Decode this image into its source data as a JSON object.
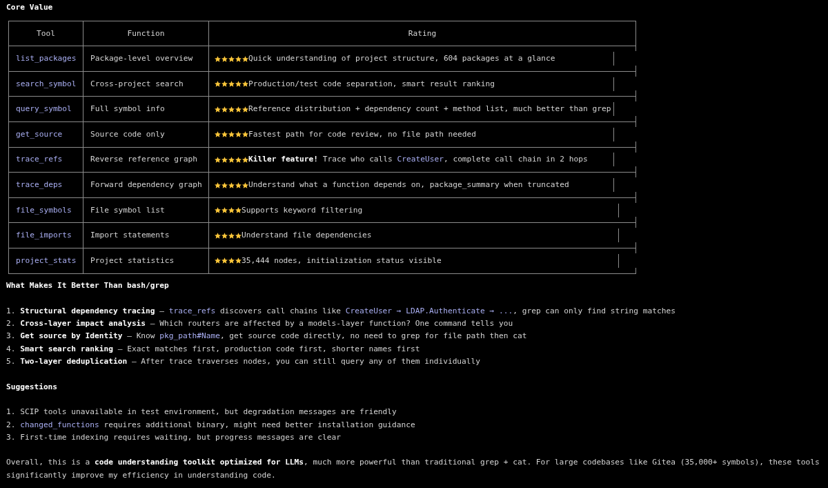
{
  "heading": "Core Value",
  "table": {
    "columns": [
      "Tool",
      "Function",
      "Rating"
    ],
    "rows": [
      {
        "tool": "list_packages",
        "function": "Package-level overview",
        "stars": 5,
        "rating": [
          {
            "kind": "plain",
            "text": "Quick understanding of project structure, 604 packages at a glance"
          }
        ]
      },
      {
        "tool": "search_symbol",
        "function": "Cross-project search",
        "stars": 5,
        "rating": [
          {
            "kind": "plain",
            "text": "Production/test code separation, smart result ranking"
          }
        ]
      },
      {
        "tool": "query_symbol",
        "function": "Full symbol info",
        "stars": 5,
        "rating": [
          {
            "kind": "plain",
            "text": "Reference distribution + dependency count + method list, much better than grep"
          }
        ]
      },
      {
        "tool": "get_source",
        "function": "Source code only",
        "stars": 5,
        "rating": [
          {
            "kind": "plain",
            "text": "Fastest path for code review, no file path needed"
          }
        ]
      },
      {
        "tool": "trace_refs",
        "function": "Reverse reference graph",
        "stars": 5,
        "rating": [
          {
            "kind": "bold",
            "text": "Killer feature!"
          },
          {
            "kind": "plain",
            "text": " Trace who calls "
          },
          {
            "kind": "code",
            "text": "CreateUser"
          },
          {
            "kind": "plain",
            "text": ", complete call chain in 2 hops"
          }
        ]
      },
      {
        "tool": "trace_deps",
        "function": "Forward dependency graph",
        "stars": 5,
        "rating": [
          {
            "kind": "plain",
            "text": "Understand what a function depends on, package_summary when truncated"
          }
        ]
      },
      {
        "tool": "file_symbols",
        "function": "File symbol list",
        "stars": 4,
        "rating": [
          {
            "kind": "plain",
            "text": "Supports keyword filtering"
          }
        ]
      },
      {
        "tool": "file_imports",
        "function": "Import statements",
        "stars": 4,
        "rating": [
          {
            "kind": "plain",
            "text": "Understand file dependencies"
          }
        ]
      },
      {
        "tool": "project_stats",
        "function": "Project statistics",
        "stars": 4,
        "rating": [
          {
            "kind": "plain",
            "text": "35,444 nodes, initialization status visible"
          }
        ]
      }
    ]
  },
  "sections": [
    {
      "title": "What Makes It Better Than bash/grep",
      "items": [
        {
          "number": "1.",
          "parts": [
            {
              "kind": "bold",
              "text": "Structural dependency tracing"
            },
            {
              "kind": "plain",
              "text": " – "
            },
            {
              "kind": "code",
              "text": "trace_refs"
            },
            {
              "kind": "plain",
              "text": " discovers call chains like "
            },
            {
              "kind": "code",
              "text": "CreateUser → LDAP.Authenticate → ..."
            },
            {
              "kind": "plain",
              "text": ", grep can only find string matches"
            }
          ]
        },
        {
          "number": "2.",
          "parts": [
            {
              "kind": "bold",
              "text": "Cross-layer impact analysis"
            },
            {
              "kind": "plain",
              "text": " – Which routers are affected by a models-layer function? One command tells you"
            }
          ]
        },
        {
          "number": "3.",
          "parts": [
            {
              "kind": "bold",
              "text": "Get source by Identity"
            },
            {
              "kind": "plain",
              "text": " – Know "
            },
            {
              "kind": "code",
              "text": "pkg_path#Name"
            },
            {
              "kind": "plain",
              "text": ", get source code directly, no need to grep for file path then cat"
            }
          ]
        },
        {
          "number": "4.",
          "parts": [
            {
              "kind": "bold",
              "text": "Smart search ranking"
            },
            {
              "kind": "plain",
              "text": " – Exact matches first, production code first, shorter names first"
            }
          ]
        },
        {
          "number": "5.",
          "parts": [
            {
              "kind": "bold",
              "text": "Two-layer deduplication"
            },
            {
              "kind": "plain",
              "text": " – After trace traverses nodes, you can still query any of them individually"
            }
          ]
        }
      ]
    },
    {
      "title": "Suggestions",
      "items": [
        {
          "number": "1.",
          "parts": [
            {
              "kind": "plain",
              "text": "SCIP tools unavailable in test environment, but degradation messages are friendly"
            }
          ]
        },
        {
          "number": "2.",
          "parts": [
            {
              "kind": "code",
              "text": "changed_functions"
            },
            {
              "kind": "plain",
              "text": " requires additional binary, might need better installation guidance"
            }
          ]
        },
        {
          "number": "3.",
          "parts": [
            {
              "kind": "plain",
              "text": "First-time indexing requires waiting, but progress messages are clear"
            }
          ]
        }
      ]
    }
  ],
  "summary": [
    {
      "kind": "plain",
      "text": "Overall, this is a "
    },
    {
      "kind": "bold",
      "text": "code understanding toolkit optimized for LLMs"
    },
    {
      "kind": "plain",
      "text": ", much more powerful than traditional grep + cat. For large codebases like Gitea (35,000+ symbols), these tools significantly improve my efficiency in understanding code."
    }
  ]
}
